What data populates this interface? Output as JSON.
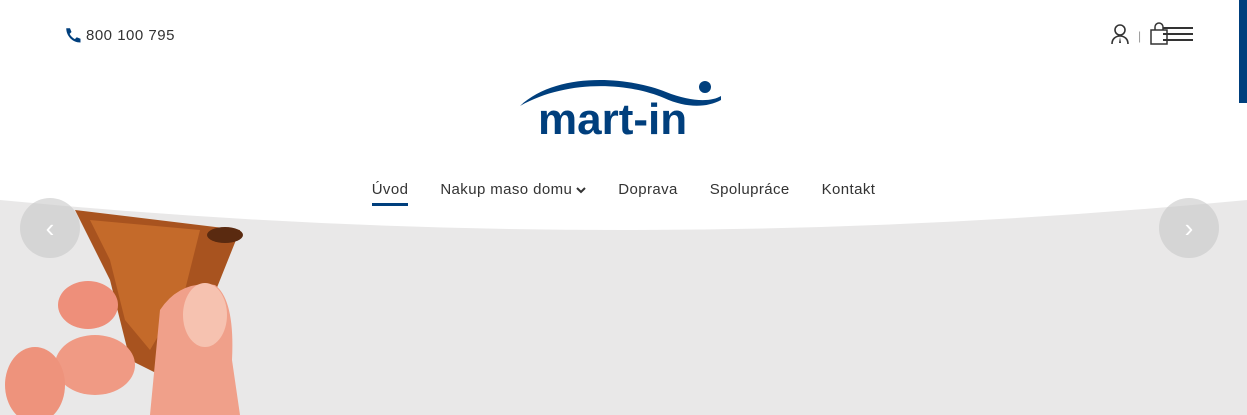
{
  "header": {
    "phone": "800 100 795",
    "icons": [
      "phone-icon",
      "user-icon",
      "shopping-bag-icon",
      "menu-icon"
    ],
    "separator": "|",
    "accent_color": "#003f7d"
  },
  "logo": {
    "text": "mart-in"
  },
  "nav": {
    "items": [
      {
        "label": "Úvod",
        "active": true
      },
      {
        "label": "Nakup maso domu",
        "has_dropdown": true
      },
      {
        "label": "Doprava"
      },
      {
        "label": "Spolupráce"
      },
      {
        "label": "Kontakt"
      }
    ]
  },
  "slider": {
    "prev": "‹",
    "next": "›"
  }
}
